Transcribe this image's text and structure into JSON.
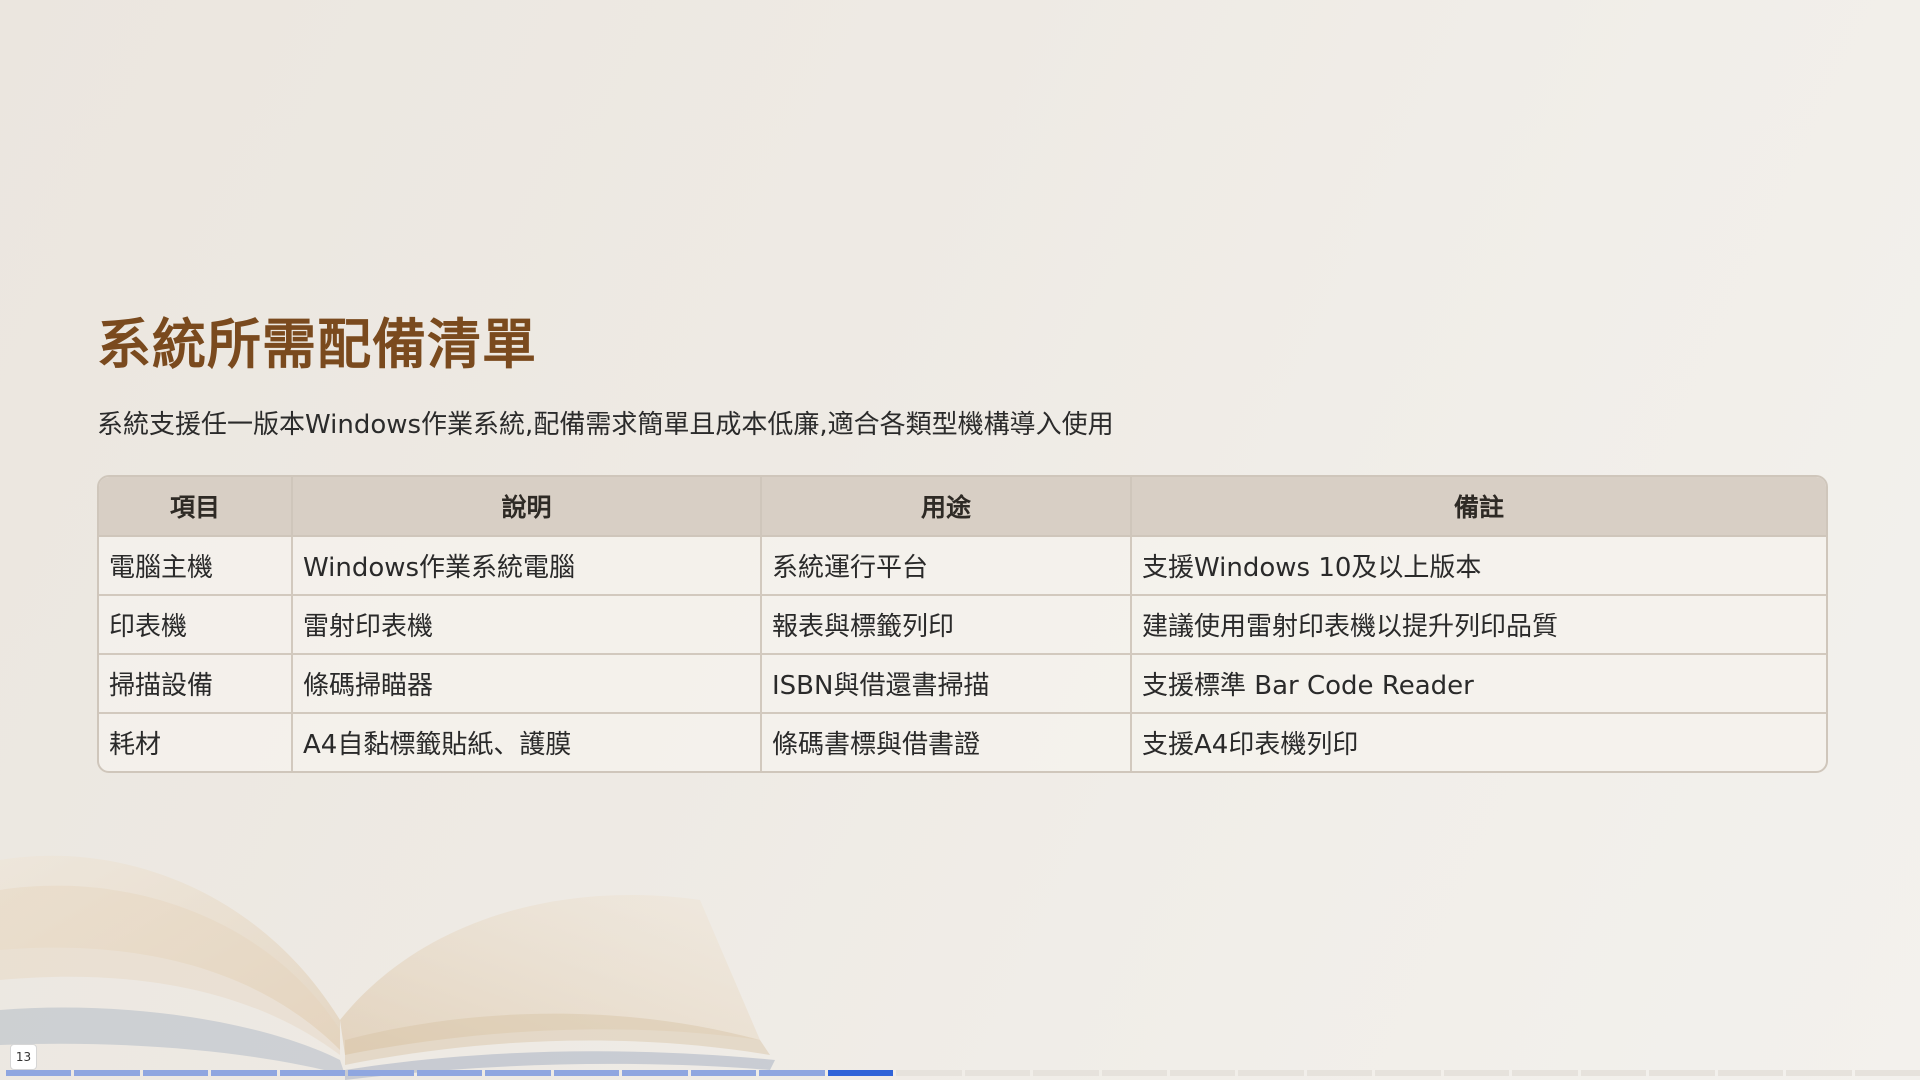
{
  "slide": {
    "title": "系統所需配備清單",
    "subtitle": "系統支援任一版本Windows作業系統,配備需求簡單且成本低廉,適合各類型機構導入使用",
    "page_number": "13"
  },
  "table": {
    "headers": [
      "項目",
      "說明",
      "用途",
      "備註"
    ],
    "rows": [
      [
        "電腦主機",
        "Windows作業系統電腦",
        "系統運行平台",
        "支援Windows 10及以上版本"
      ],
      [
        "印表機",
        "雷射印表機",
        "報表與標籤列印",
        "建議使用雷射印表機以提升列印品質"
      ],
      [
        "掃描設備",
        "條碼掃瞄器",
        "ISBN與借還書掃描",
        "支援標準 Bar Code Reader"
      ],
      [
        "耗材",
        "A4自黏標籤貼紙、護膜",
        "條碼書標與借書證",
        "支援A4印表機列印"
      ]
    ]
  },
  "progress": {
    "total_slides": 28,
    "current_slide": 13
  },
  "colors": {
    "title": "#7a4a1e",
    "header_bg": "#d8cfc5",
    "progress_done": "#8fa6e0",
    "progress_current": "#2f63d8"
  }
}
